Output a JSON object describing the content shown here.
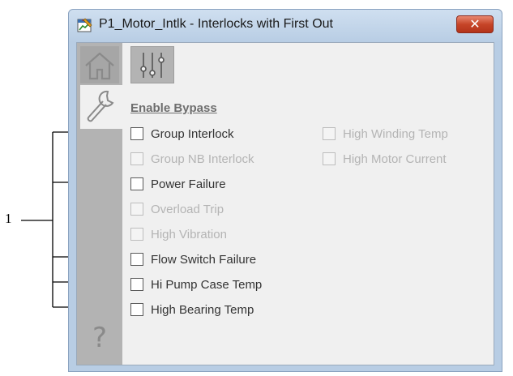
{
  "callout": {
    "number": "1"
  },
  "window": {
    "title": "P1_Motor_Intlk - Interlocks with First Out",
    "close_glyph": "✕"
  },
  "nav": {
    "help_glyph": "?"
  },
  "section": {
    "title": "Enable Bypass"
  },
  "left_column": [
    {
      "label": "Group Interlock",
      "enabled": true
    },
    {
      "label": "Group NB Interlock",
      "enabled": false
    },
    {
      "label": "Power Failure",
      "enabled": true
    },
    {
      "label": "Overload Trip",
      "enabled": false
    },
    {
      "label": "High Vibration",
      "enabled": false
    },
    {
      "label": "Flow Switch Failure",
      "enabled": true
    },
    {
      "label": "Hi Pump Case Temp",
      "enabled": true
    },
    {
      "label": "High Bearing Temp",
      "enabled": true
    }
  ],
  "right_column": [
    {
      "label": "High Winding Temp",
      "enabled": false
    },
    {
      "label": "High Motor Current",
      "enabled": false
    }
  ]
}
